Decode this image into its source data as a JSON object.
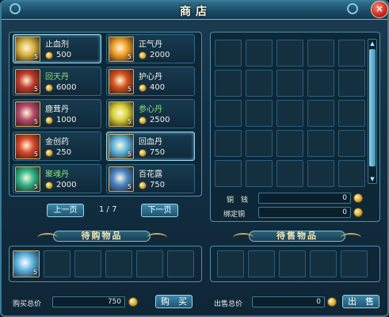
{
  "window": {
    "title": "商店",
    "close_label": "×"
  },
  "shop_items": [
    {
      "name": "止血剂",
      "price": "500",
      "count": "5",
      "green": false,
      "selected": true,
      "color": "#d8b341"
    },
    {
      "name": "正气丹",
      "price": "2000",
      "count": "5",
      "green": false,
      "selected": false,
      "color": "#f0a02a"
    },
    {
      "name": "回天丹",
      "price": "6000",
      "count": "5",
      "green": true,
      "selected": false,
      "color": "#c23c2c"
    },
    {
      "name": "护心丹",
      "price": "400",
      "count": "5",
      "green": false,
      "selected": false,
      "color": "#d2521c"
    },
    {
      "name": "鹿茸丹",
      "price": "1000",
      "count": "5",
      "green": false,
      "selected": false,
      "color": "#b64a6a"
    },
    {
      "name": "参心丹",
      "price": "2500",
      "count": "5",
      "green": true,
      "selected": false,
      "color": "#d8d23a"
    },
    {
      "name": "金创药",
      "price": "250",
      "count": "5",
      "green": false,
      "selected": false,
      "color": "#d7472c"
    },
    {
      "name": "回血丹",
      "price": "750",
      "count": "5",
      "green": false,
      "selected": true,
      "color": "#5fb6e0"
    },
    {
      "name": "聚魂丹",
      "price": "2000",
      "count": "5",
      "green": true,
      "selected": false,
      "color": "#2fb68a"
    },
    {
      "name": "百花露",
      "price": "750",
      "count": "5",
      "green": false,
      "selected": false,
      "color": "#4a86c8"
    }
  ],
  "pager": {
    "prev": "上一页",
    "next": "下一页",
    "page": "1 / 7"
  },
  "money": {
    "copper_label": "铜　钱",
    "copper_value": "0",
    "bound_label": "绑定铜",
    "bound_value": "0"
  },
  "buy": {
    "title": "待购物品",
    "first_slot_count": "5",
    "total_label": "购买总价",
    "total_value": "750",
    "button": "购　买"
  },
  "sell": {
    "title": "待售物品",
    "total_label": "出售总价",
    "total_value": "0",
    "button": "出　售"
  }
}
